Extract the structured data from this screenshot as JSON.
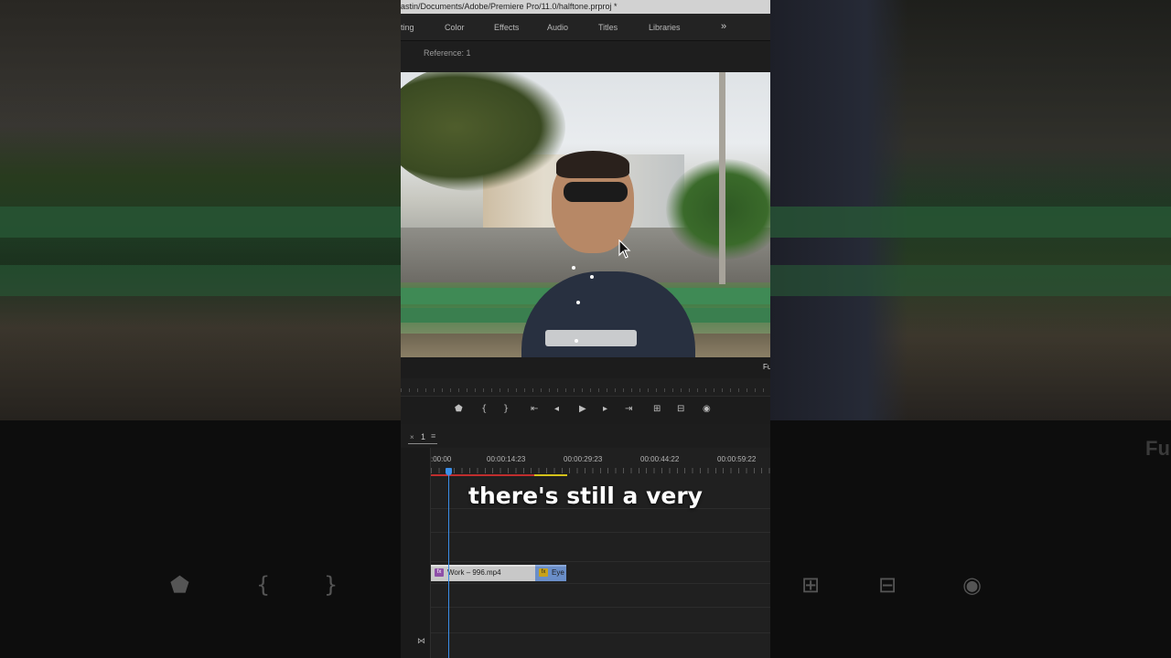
{
  "window": {
    "title": "astin/Documents/Adobe/Premiere Pro/11.0/halftone.prproj *"
  },
  "workspaces": {
    "tabs": [
      "ting",
      "Color",
      "Effects",
      "Audio",
      "Titles",
      "Libraries"
    ],
    "more": "»"
  },
  "program_monitor": {
    "reference_label": "Reference: 1",
    "fit_label": "Fu"
  },
  "transport": {
    "buttons": [
      {
        "name": "add-marker-icon",
        "glyph": "⬟"
      },
      {
        "name": "mark-in-icon",
        "glyph": "{"
      },
      {
        "name": "mark-out-icon",
        "glyph": "}"
      },
      {
        "name": "go-to-in-icon",
        "glyph": "⇤"
      },
      {
        "name": "step-back-icon",
        "glyph": "◂"
      },
      {
        "name": "play-icon",
        "glyph": "▶"
      },
      {
        "name": "step-forward-icon",
        "glyph": "▸"
      },
      {
        "name": "go-to-out-icon",
        "glyph": "⇥"
      },
      {
        "name": "lift-icon",
        "glyph": "⊞"
      },
      {
        "name": "extract-icon",
        "glyph": "⊟"
      },
      {
        "name": "export-frame-icon",
        "glyph": "◉"
      }
    ]
  },
  "timeline": {
    "close": "×",
    "sequence": "1",
    "menu": "≡",
    "ruler_times": [
      ":00:00",
      "00:00:14:23",
      "00:00:29:23",
      "00:00:44:22",
      "00:00:59:22"
    ],
    "clips": [
      {
        "label": "Work – 996.mp4",
        "fx": "fx"
      },
      {
        "label": "Eye",
        "fx": "fx"
      }
    ],
    "footer_icon": "⋈"
  },
  "caption": {
    "text": "there's still a very"
  },
  "background": {
    "ghost_label": "Fu"
  },
  "colors": {
    "playhead": "#3b8ee8",
    "render_red": "#c02e2e",
    "render_yellow": "#d4c21a",
    "clip_video": "#c8c8c8",
    "clip_adjust": "#6a8ec8"
  }
}
